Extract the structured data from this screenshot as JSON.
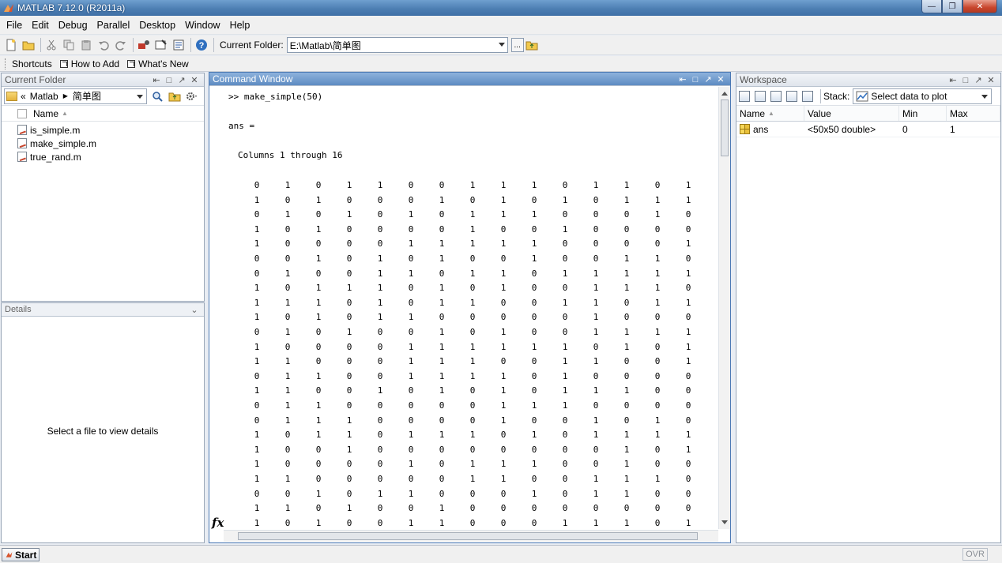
{
  "window": {
    "title": "MATLAB  7.12.0 (R2011a)"
  },
  "menu": [
    "File",
    "Edit",
    "Debug",
    "Parallel",
    "Desktop",
    "Window",
    "Help"
  ],
  "toolbar": {
    "current_folder_label": "Current Folder:",
    "current_folder_value": "E:\\Matlab\\简单图",
    "browse_label": "..."
  },
  "shortcuts": {
    "items": [
      "Shortcuts",
      "How to Add",
      "What's New"
    ]
  },
  "current_folder": {
    "title": "Current Folder",
    "address_prefix": "«",
    "address_parts": [
      "Matlab",
      "简单图"
    ],
    "column_name": "Name",
    "files": [
      "is_simple.m",
      "make_simple.m",
      "true_rand.m"
    ]
  },
  "details": {
    "title": "Details",
    "message": "Select a file to view details"
  },
  "command_window": {
    "title": "Command Window",
    "command": ">> make_simple(50)",
    "ans_label": "ans =",
    "columns_label": "Columns 1 through 16",
    "fx_label": "fx",
    "matrix": [
      [
        0,
        1,
        0,
        1,
        1,
        0,
        0,
        1,
        1,
        1,
        0,
        1,
        1,
        0,
        1
      ],
      [
        1,
        0,
        1,
        0,
        0,
        0,
        1,
        0,
        1,
        0,
        1,
        0,
        1,
        1,
        1
      ],
      [
        0,
        1,
        0,
        1,
        0,
        1,
        0,
        1,
        1,
        1,
        0,
        0,
        0,
        1,
        0
      ],
      [
        1,
        0,
        1,
        0,
        0,
        0,
        0,
        1,
        0,
        0,
        1,
        0,
        0,
        0,
        0
      ],
      [
        1,
        0,
        0,
        0,
        0,
        1,
        1,
        1,
        1,
        1,
        0,
        0,
        0,
        0,
        1
      ],
      [
        0,
        0,
        1,
        0,
        1,
        0,
        1,
        0,
        0,
        1,
        0,
        0,
        1,
        1,
        0
      ],
      [
        0,
        1,
        0,
        0,
        1,
        1,
        0,
        1,
        1,
        0,
        1,
        1,
        1,
        1,
        1
      ],
      [
        1,
        0,
        1,
        1,
        1,
        0,
        1,
        0,
        1,
        0,
        0,
        1,
        1,
        1,
        0
      ],
      [
        1,
        1,
        1,
        0,
        1,
        0,
        1,
        1,
        0,
        0,
        1,
        1,
        0,
        1,
        1
      ],
      [
        1,
        0,
        1,
        0,
        1,
        1,
        0,
        0,
        0,
        0,
        0,
        1,
        0,
        0,
        0
      ],
      [
        0,
        1,
        0,
        1,
        0,
        0,
        1,
        0,
        1,
        0,
        0,
        1,
        1,
        1,
        1
      ],
      [
        1,
        0,
        0,
        0,
        0,
        1,
        1,
        1,
        1,
        1,
        1,
        0,
        1,
        0,
        1
      ],
      [
        1,
        1,
        0,
        0,
        0,
        1,
        1,
        1,
        0,
        0,
        1,
        1,
        0,
        0,
        1
      ],
      [
        0,
        1,
        1,
        0,
        0,
        1,
        1,
        1,
        1,
        0,
        1,
        0,
        0,
        0,
        0
      ],
      [
        1,
        1,
        0,
        0,
        1,
        0,
        1,
        0,
        1,
        0,
        1,
        1,
        1,
        0,
        0
      ],
      [
        0,
        1,
        1,
        0,
        0,
        0,
        0,
        0,
        1,
        1,
        1,
        0,
        0,
        0,
        0
      ],
      [
        0,
        1,
        1,
        1,
        0,
        0,
        0,
        0,
        1,
        0,
        0,
        1,
        0,
        1,
        0
      ],
      [
        1,
        0,
        1,
        1,
        0,
        1,
        1,
        1,
        0,
        1,
        0,
        1,
        1,
        1,
        1
      ],
      [
        1,
        0,
        0,
        1,
        0,
        0,
        0,
        0,
        0,
        0,
        0,
        0,
        1,
        0,
        1
      ],
      [
        1,
        0,
        0,
        0,
        0,
        1,
        0,
        1,
        1,
        1,
        0,
        0,
        1,
        0,
        0
      ],
      [
        1,
        1,
        0,
        0,
        0,
        0,
        0,
        1,
        1,
        0,
        0,
        1,
        1,
        1,
        0
      ],
      [
        0,
        0,
        1,
        0,
        1,
        1,
        0,
        0,
        0,
        1,
        0,
        1,
        1,
        0,
        0
      ],
      [
        1,
        1,
        0,
        1,
        0,
        0,
        1,
        0,
        0,
        0,
        0,
        0,
        0,
        0,
        0
      ],
      [
        1,
        0,
        1,
        0,
        0,
        1,
        1,
        0,
        0,
        0,
        1,
        1,
        1,
        0,
        1
      ]
    ]
  },
  "workspace": {
    "title": "Workspace",
    "stack_label": "Stack:",
    "plot_label": "Select data to plot",
    "columns": [
      "Name",
      "Value",
      "Min",
      "Max"
    ],
    "variables": [
      {
        "name": "ans",
        "value": "<50x50 double>",
        "min": "0",
        "max": "1"
      }
    ]
  },
  "status": {
    "start_label": "Start",
    "ovr_label": "OVR"
  }
}
